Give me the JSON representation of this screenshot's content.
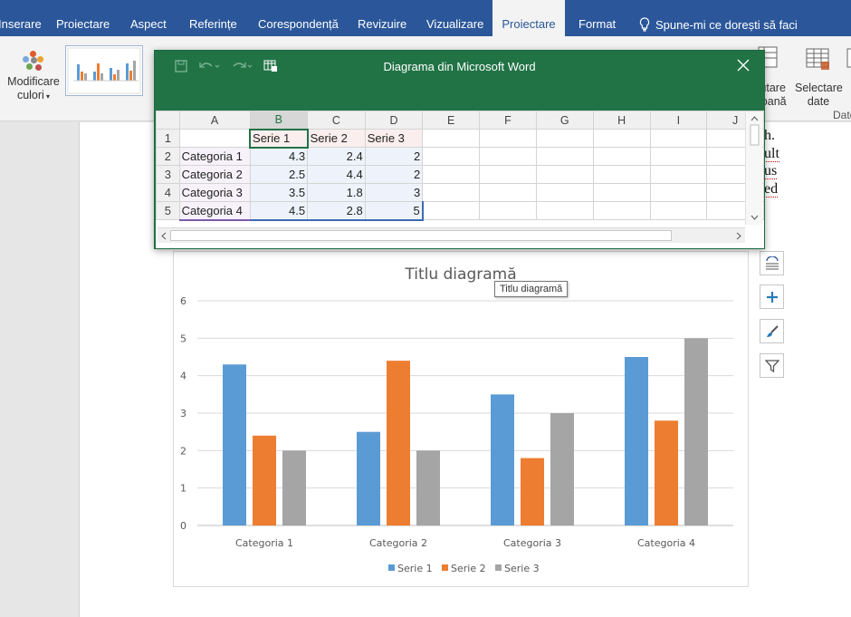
{
  "ribbon": {
    "tabs": [
      "Inserare",
      "Proiectare",
      "Aspect",
      "Referințe",
      "Corespondență",
      "Revizuire",
      "Vizualizare",
      "Proiectare",
      "Format"
    ],
    "active_tab_index": 7,
    "tell_me": "Spune-mi ce dorești să faci",
    "modify_colors": [
      "Modificare",
      "culori"
    ],
    "switch_row_col": [
      "omutare",
      "/coloană"
    ],
    "select_data": [
      "Selectare",
      "date"
    ],
    "edit_data_partial": "E",
    "group_label_partial": "Date",
    "accent": "#2b579a"
  },
  "document": {
    "text_lines": [
      "h.",
      "ult",
      "us",
      "ed"
    ]
  },
  "excel": {
    "title": "Diagrama din Microsoft Word",
    "accent": "#217346",
    "columns": [
      "A",
      "B",
      "C",
      "D",
      "E",
      "F",
      "G",
      "H",
      "I",
      "J"
    ],
    "rows": [
      {
        "n": "1",
        "a": "",
        "b": "Serie 1",
        "c": "Serie 2",
        "d": "Serie 3"
      },
      {
        "n": "2",
        "a": "Categoria 1",
        "b": "4.3",
        "c": "2.4",
        "d": "2"
      },
      {
        "n": "3",
        "a": "Categoria 2",
        "b": "2.5",
        "c": "4.4",
        "d": "2"
      },
      {
        "n": "4",
        "a": "Categoria 3",
        "b": "3.5",
        "c": "1.8",
        "d": "3"
      },
      {
        "n": "5",
        "a": "Categoria 4",
        "b": "4.5",
        "c": "2.8",
        "d": "5"
      }
    ]
  },
  "tooltip": "Titlu diagramă",
  "chart_data": {
    "type": "bar",
    "title": "Titlu diagramă",
    "categories": [
      "Categoria 1",
      "Categoria 2",
      "Categoria 3",
      "Categoria 4"
    ],
    "series": [
      {
        "name": "Serie 1",
        "values": [
          4.3,
          2.5,
          3.5,
          4.5
        ],
        "color": "#5b9bd5"
      },
      {
        "name": "Serie 2",
        "values": [
          2.4,
          4.4,
          1.8,
          2.8
        ],
        "color": "#ed7d31"
      },
      {
        "name": "Serie 3",
        "values": [
          2,
          2,
          3,
          5
        ],
        "color": "#a5a5a5"
      }
    ],
    "ylim": [
      0,
      6
    ],
    "yticks": [
      "0",
      "1",
      "2",
      "3",
      "4",
      "5",
      "6"
    ],
    "grid": true,
    "legend": "bottom"
  }
}
